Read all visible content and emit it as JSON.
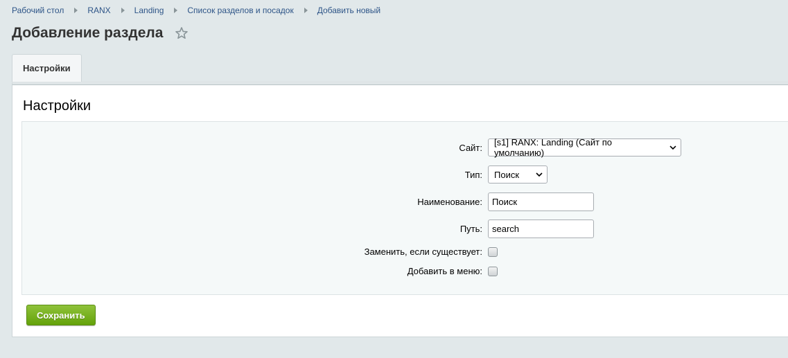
{
  "breadcrumb": [
    "Рабочий стол",
    "RANX",
    "Landing",
    "Список разделов и посадок",
    "Добавить новый"
  ],
  "page": {
    "title": "Добавление раздела"
  },
  "tabs": [
    {
      "label": "Настройки",
      "active": true
    }
  ],
  "section": {
    "title": "Настройки"
  },
  "form": {
    "site": {
      "label": "Сайт:",
      "value": "[s1] RANX: Landing (Сайт по умолчанию)"
    },
    "type": {
      "label": "Тип:",
      "value": "Поиск"
    },
    "name": {
      "label": "Наименование:",
      "value": "Поиск"
    },
    "path": {
      "label": "Путь:",
      "value": "search"
    },
    "replace": {
      "label": "Заменить, если существует:",
      "checked": false
    },
    "add_menu": {
      "label": "Добавить в меню:",
      "checked": false
    }
  },
  "actions": {
    "save_label": "Сохранить"
  },
  "colors": {
    "link": "#2d5487",
    "save_button": "#73ac1c",
    "background": "#e1e8ea"
  }
}
